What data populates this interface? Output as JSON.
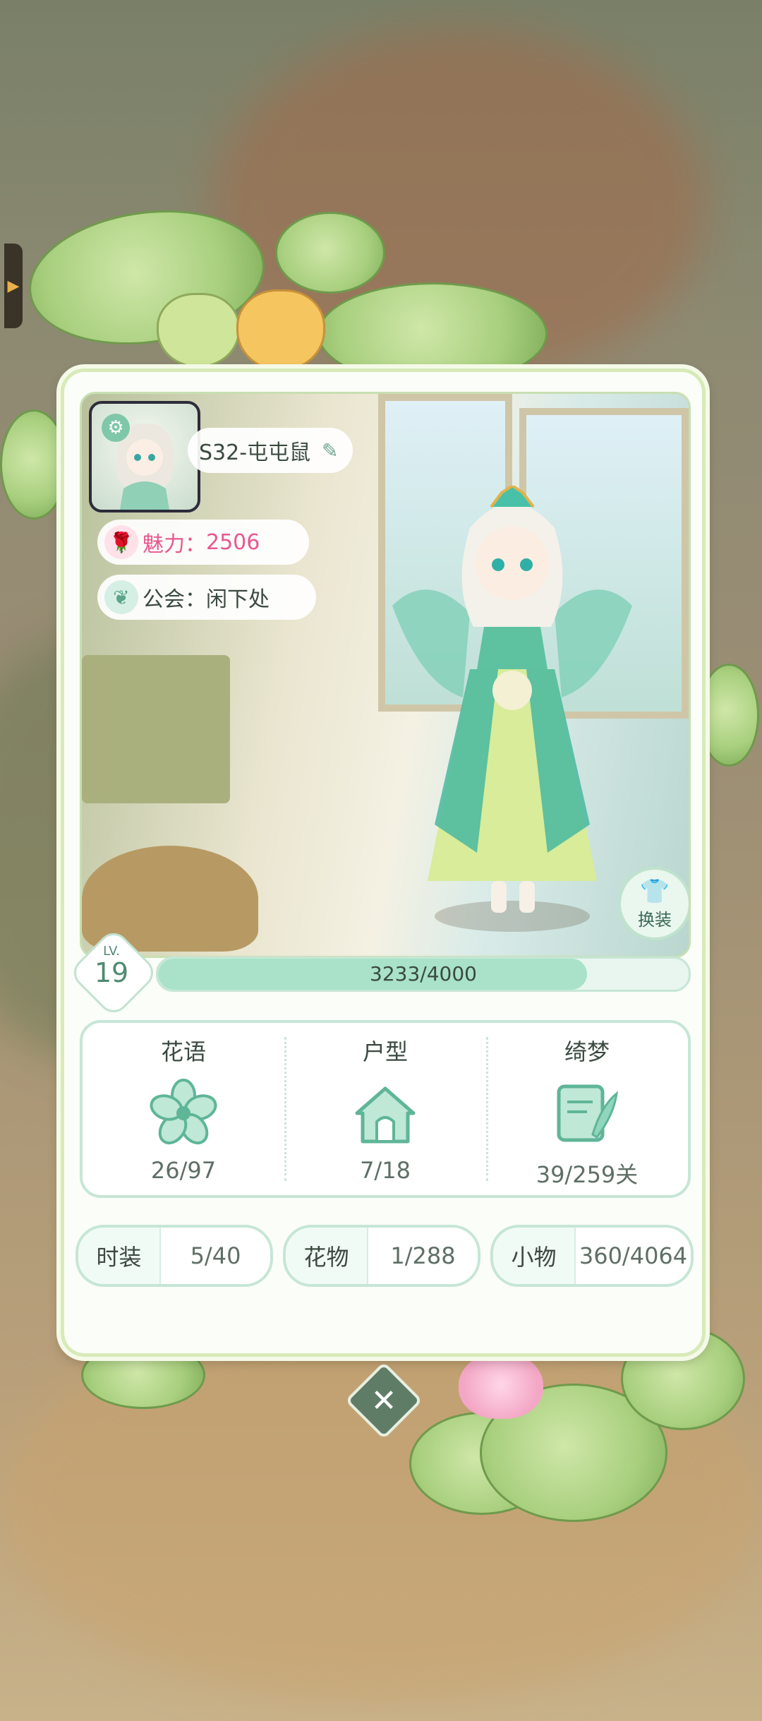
{
  "profile": {
    "name": "S32-屯屯鼠",
    "charm_label": "魅力：",
    "charm_value": "2506",
    "guild_label": "公会：",
    "guild_value": "闲下处"
  },
  "level": {
    "prefix": "LV.",
    "value": "19",
    "xp_text": "3233/4000",
    "xp_fraction": 0.808
  },
  "actions": {
    "change_outfit": "换装"
  },
  "stats": [
    {
      "title": "花语",
      "value": "26/97",
      "icon": "flower-icon"
    },
    {
      "title": "户型",
      "value": "7/18",
      "icon": "house-icon"
    },
    {
      "title": "绮梦",
      "value": "39/259关",
      "icon": "dream-letter-icon"
    }
  ],
  "collections": [
    {
      "label": "时装",
      "value": "5/40"
    },
    {
      "label": "花物",
      "value": "1/288"
    },
    {
      "label": "小物",
      "value": "360/4064"
    }
  ],
  "colors": {
    "accent_green": "#a9e2c8",
    "border_green": "#c6e6d6",
    "charm_pink": "#e8578f"
  }
}
